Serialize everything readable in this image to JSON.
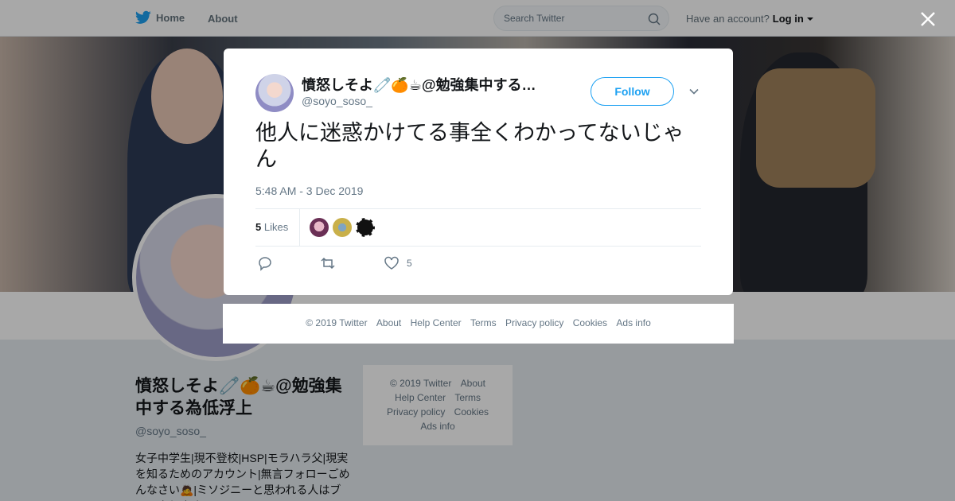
{
  "nav": {
    "home_label": "Home",
    "about_label": "About",
    "search_placeholder": "Search Twitter",
    "account_prompt": "Have an account?",
    "login_label": "Log in"
  },
  "profile": {
    "name": "憤怒しそよ🧷🍊☕@勉強集中する為低浮上",
    "handle": "@soyo_soso_",
    "bio": "女子中学生|現不登校|HSP|モラハラ父|現実を知るためのアカウント|無言フォローごめんなさい🙇|ミソジニーと思われる人はブロックします"
  },
  "side_footer": {
    "items": [
      "© 2019 Twitter",
      "About",
      "Help Center",
      "Terms",
      "Privacy policy",
      "Cookies",
      "Ads info"
    ]
  },
  "tweet": {
    "author_name": "憤怒しそよ🧷🍊☕@勉強集中する…",
    "author_handle": "@soyo_soso_",
    "follow_label": "Follow",
    "text": "他人に迷惑かけてる事全くわかってないじゃん",
    "timestamp": "5:48 AM - 3 Dec 2019",
    "likes_count": "5",
    "likes_label": "Likes",
    "action_like_count": "5"
  },
  "modal_footer": {
    "items": [
      "© 2019 Twitter",
      "About",
      "Help Center",
      "Terms",
      "Privacy policy",
      "Cookies",
      "Ads info"
    ]
  },
  "colors": {
    "accent": "#1da1f2",
    "muted": "#657786",
    "background": "#e6ecf0"
  }
}
